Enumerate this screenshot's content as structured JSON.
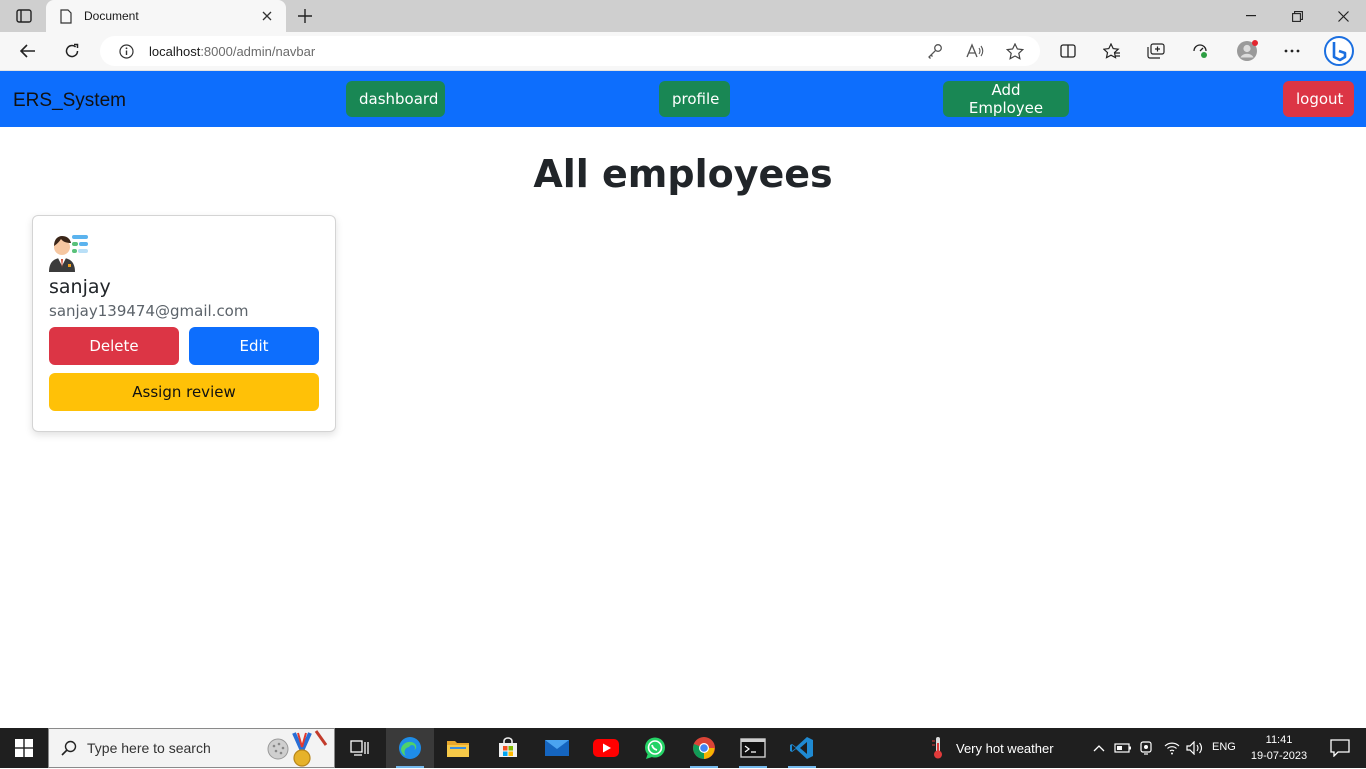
{
  "browser": {
    "tab_title": "Document",
    "url_host": "localhost",
    "url_path": ":8000/admin/navbar"
  },
  "navbar": {
    "brand": "ERS_System",
    "dashboard_label": "dashboard",
    "profile_label": "profile",
    "add_employee_label": "Add Employee",
    "logout_label": "logout"
  },
  "main": {
    "heading": "All employees",
    "employees": [
      {
        "name": "sanjay",
        "email": "sanjay139474@gmail.com",
        "delete_label": "Delete",
        "edit_label": "Edit",
        "assign_label": "Assign review"
      }
    ]
  },
  "taskbar": {
    "search_placeholder": "Type here to search",
    "weather": "Very hot weather",
    "language": "ENG",
    "time": "11:41",
    "date": "19-07-2023"
  },
  "colors": {
    "primary": "#0d6efd",
    "success": "#198754",
    "danger": "#dc3545",
    "warning": "#ffc107"
  }
}
